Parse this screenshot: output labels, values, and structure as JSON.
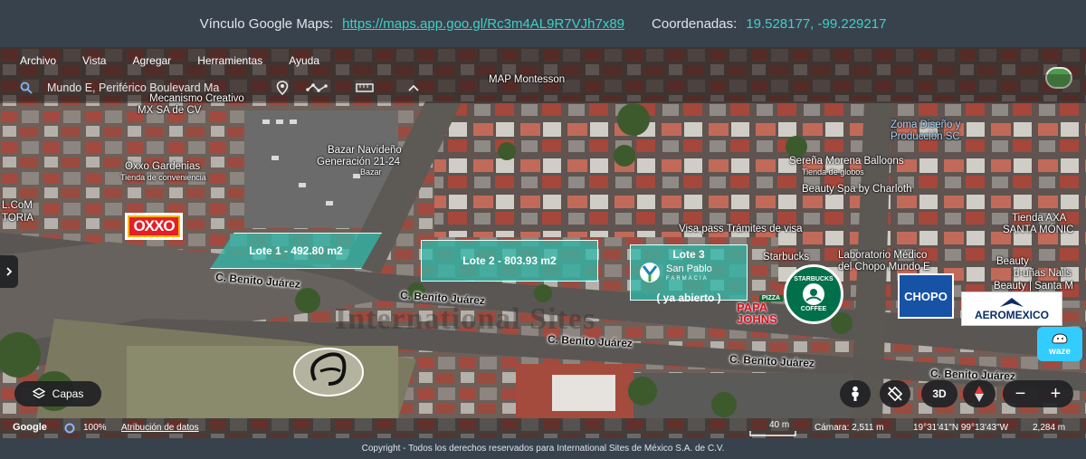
{
  "header": {
    "maps_label": "Vínculo Google Maps:",
    "maps_url": "https://maps.app.goo.gl/Rc3m4AL9R7VJh7x89",
    "coords_label": "Coordenadas:",
    "coords_value": "19.528177, -99.229217"
  },
  "menu": {
    "items": [
      "Archivo",
      "Vista",
      "Agregar",
      "Herramientas",
      "Ayuda"
    ]
  },
  "toolbar": {
    "search_text": "Mundo E, Periférico Boulevard Ma"
  },
  "places": {
    "map_montesson": "MAP Montesson",
    "mecanismo": "Mecanismo Creativo",
    "mx_sa": "MX SA de CV",
    "oxxo_gardenias": "Oxxo Gardenias",
    "tienda_conveniencia": "Tienda de conveniencia",
    "bazar_1": "Bazar Navideño",
    "bazar_2": "Generación 21-24",
    "bazar_3": "Bazar",
    "com": "L.CoM",
    "toria": "TORIA",
    "zoma_1": "Zoma Diseño y",
    "zoma_2": "Producción SC",
    "serena": "Sereña Morena Balloons",
    "tienda_globos": "Tienda de globos",
    "beauty_spa": "Beauty Spa by Charloth",
    "tienda_axa": "Tienda AXA",
    "santa_monica": "SANTA MÓNIC",
    "visa": "Visa pass Trámites de visa",
    "starbucks": "Starbucks",
    "lab_1": "Laboratorio Médico",
    "lab_2": "del Chopo Mundo E",
    "beauty_1": "Beauty",
    "beauty_2": "Beauty | Santa M",
    "unas": "d-uñas Nails"
  },
  "streets": {
    "s1": "C. Benito Juárez",
    "s2": "C. Benito Juárez",
    "s3": "C. Benito Juárez",
    "s4": "C. Benito Juárez",
    "s5": "C. Benito Juárez"
  },
  "lots": {
    "lot1": "Lote 1 - 492.80 m2",
    "lot2": "Lote 2 - 803.93 m2",
    "lot3_title": "Lote 3",
    "lot3_status": "( ya abierto )"
  },
  "brands": {
    "oxxo": "OXXO",
    "san_pablo": "San Pablo",
    "farmacia": "FARMACIA",
    "starbucks_top": "STARBUCKS",
    "starbucks_bottom": "COFFEE",
    "papa_johns_top": "PIZZA",
    "papa_johns": "PAPA JOHNS",
    "chopo": "CHOPO",
    "aeromexico": "AEROMEXICO",
    "waze": "waze"
  },
  "watermark": "International Sites",
  "controls": {
    "layers": "Capas",
    "three_d": "3D",
    "zoom_in": "+",
    "zoom_out": "−"
  },
  "status": {
    "google": "Google",
    "zoom_pct": "100%",
    "attribution": "Atribución de datos",
    "scale": "40 m",
    "camera": "Cámara: 2,511 m",
    "position": "19°31'41\"N 99°13'43\"W",
    "elevation": "2,284 m"
  },
  "footer": {
    "copyright": "Copyright - Todos los derechos reservados para International Sites de México S.A. de C.V."
  },
  "colors": {
    "header_bg": "#38424d",
    "link": "#3fd1c4",
    "lot_fill": "#30baaa"
  }
}
